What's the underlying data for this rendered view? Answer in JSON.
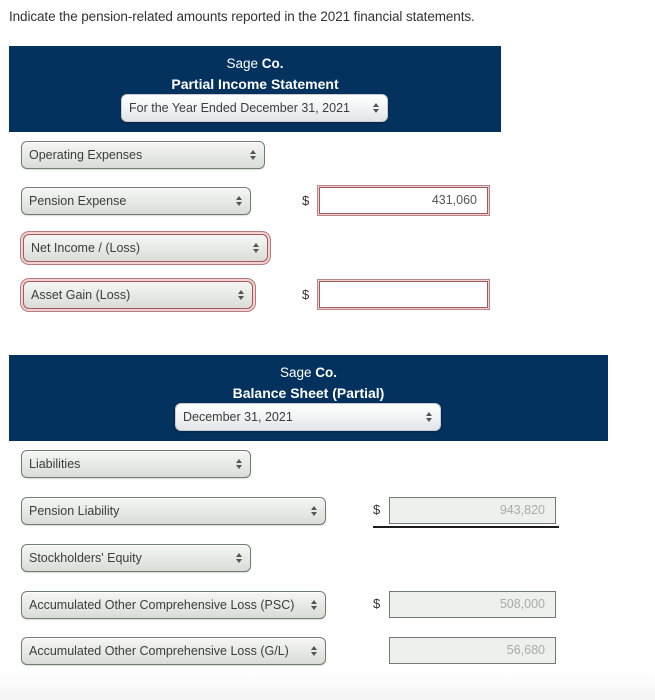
{
  "instruction": "Indicate the pension-related amounts reported in the 2021 financial statements.",
  "colors": {
    "header_bg": "#04325f",
    "error_border": "#a8575c",
    "readonly_bg": "#eef0ee"
  },
  "income_statement": {
    "company_prefix": "Sage",
    "company_suffix": "Co.",
    "title": "Partial Income Statement",
    "period_select": "For the Year Ended December 31, 2021",
    "rows": [
      {
        "label": "Operating Expenses",
        "state": "normal",
        "amount": null
      },
      {
        "label": "Pension Expense",
        "state": "normal",
        "currency": "$",
        "amount": "431,060",
        "amount_state": "error"
      },
      {
        "label": "Net Income / (Loss)",
        "state": "error",
        "amount": null
      },
      {
        "label": "Asset Gain (Loss)",
        "state": "error",
        "currency": "$",
        "amount": "",
        "amount_state": "error"
      }
    ]
  },
  "balance_sheet": {
    "company_prefix": "Sage",
    "company_suffix": "Co.",
    "title": "Balance Sheet (Partial)",
    "date_select": "December 31, 2021",
    "rows": [
      {
        "label": "Liabilities",
        "state": "normal",
        "amount": null
      },
      {
        "label": "Pension Liability",
        "state": "normal",
        "currency": "$",
        "amount": "943,820",
        "amount_state": "readonly"
      },
      {
        "label": "Stockholders' Equity",
        "state": "normal",
        "amount": null
      },
      {
        "label": "Accumulated Other Comprehensive Loss (PSC)",
        "state": "normal",
        "currency": "$",
        "amount": "508,000",
        "amount_state": "readonly"
      },
      {
        "label": "Accumulated Other Comprehensive Loss (G/L)",
        "state": "normal",
        "amount": "56,680",
        "amount_state": "readonly"
      }
    ]
  }
}
